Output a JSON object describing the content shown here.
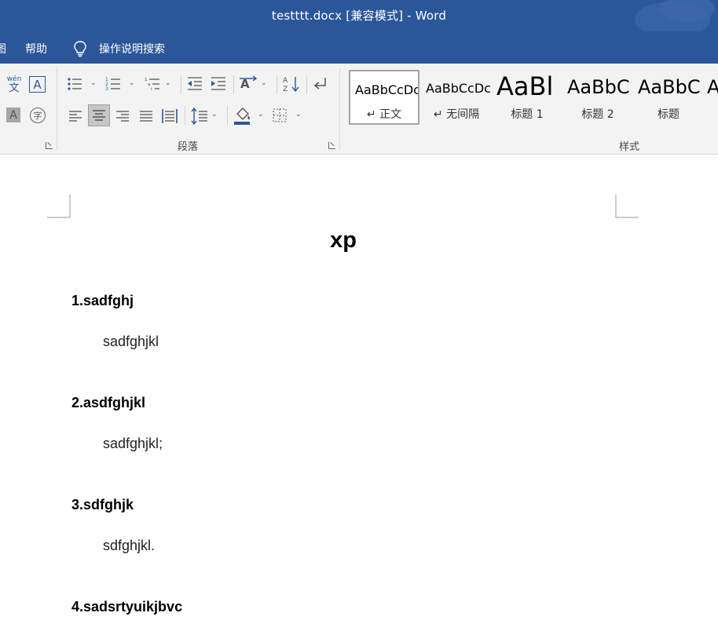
{
  "window": {
    "title": "testttt.docx [兼容模式]  -  Word"
  },
  "menu": {
    "partial_tab": "图",
    "help": "帮助",
    "search": "操作说明搜索"
  },
  "ribbon": {
    "paragraph_group_label": "段落",
    "styles_group_label": "样式",
    "phonetic_top": "wén",
    "phonetic_bottom": "文",
    "char_border_letter": "A",
    "char_shade_letter": "A",
    "enclosed_char": "字",
    "sort_letters_top": "A",
    "sort_letters_bottom": "Z",
    "styles": [
      {
        "sample": "AaBbCcDc",
        "name": "↵ 正文",
        "selected": true
      },
      {
        "sample": "AaBbCcDc",
        "name": "↵ 无间隔",
        "selected": false
      },
      {
        "sample": "AaBl",
        "name": "标题 1",
        "selected": false
      },
      {
        "sample": "AaBbC",
        "name": "标题 2",
        "selected": false
      },
      {
        "sample": "AaBbC",
        "name": "标题",
        "selected": false
      },
      {
        "sample": "A",
        "name": "",
        "selected": false
      }
    ]
  },
  "document": {
    "title": "xp",
    "sections": [
      {
        "heading": "1.sadfghj",
        "body": "sadfghjkl"
      },
      {
        "heading": "2.asdfghjkl",
        "body": "sadfghjkl;"
      },
      {
        "heading": "3.sdfghjk",
        "body": "sdfghjkl."
      },
      {
        "heading": "4.sadsrtyuikjbvc",
        "body": ""
      }
    ]
  }
}
